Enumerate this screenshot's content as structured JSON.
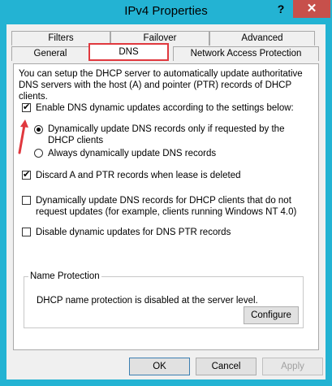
{
  "window": {
    "title": "IPv4 Properties",
    "help_label": "?",
    "close_label": "✕"
  },
  "tabs": {
    "row1": [
      "Filters",
      "Failover",
      "Advanced"
    ],
    "row2": [
      "General",
      "DNS",
      "Network Access Protection"
    ],
    "active": "DNS"
  },
  "dns": {
    "intro": "You can setup the DHCP server to automatically update authoritative DNS servers with the host (A) and pointer (PTR) records of DHCP clients.",
    "enable_updates": "Enable DNS dynamic updates according to the settings below:",
    "radio_requested": "Dynamically update DNS records only if requested by the DHCP clients",
    "radio_always": "Always dynamically update DNS records",
    "discard_records": "Discard A and PTR records when lease is deleted",
    "update_legacy": "Dynamically update DNS records for DHCP clients that do not request updates (for example, clients running Windows NT 4.0)",
    "disable_ptr": "Disable dynamic updates for DNS PTR records"
  },
  "name_protection": {
    "label": "Name Protection",
    "status": "DHCP name protection is disabled at the server level.",
    "configure": "Configure"
  },
  "footer": {
    "ok": "OK",
    "cancel": "Cancel",
    "apply": "Apply"
  },
  "colors": {
    "title_bar": "#23b3d3",
    "close_button": "#c7504b",
    "highlight": "#e0383e"
  }
}
